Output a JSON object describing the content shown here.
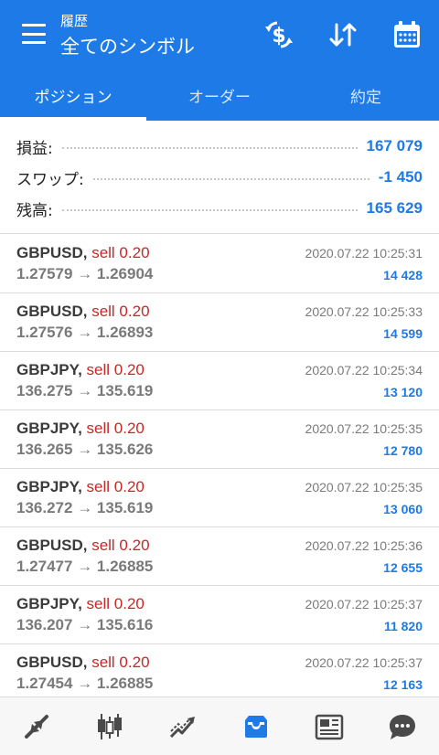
{
  "header": {
    "subtitle": "履歴",
    "title": "全てのシンボル",
    "icons": [
      "menu-icon",
      "currency-exchange-icon",
      "sort-icon",
      "calendar-icon"
    ]
  },
  "tabs": [
    {
      "label": "ポジション",
      "active": true
    },
    {
      "label": "オーダー",
      "active": false
    },
    {
      "label": "約定",
      "active": false
    }
  ],
  "summary": {
    "profit_label": "損益:",
    "profit_value": "167 079",
    "swap_label": "スワップ:",
    "swap_value": "-1 450",
    "balance_label": "残高:",
    "balance_value": "165 629"
  },
  "positions": [
    {
      "symbol": "GBPUSD,",
      "side": "sell 0.20",
      "open": "1.27579",
      "close": "1.26904",
      "time": "2020.07.22 10:25:31",
      "profit": "14 428"
    },
    {
      "symbol": "GBPUSD,",
      "side": "sell 0.20",
      "open": "1.27576",
      "close": "1.26893",
      "time": "2020.07.22 10:25:33",
      "profit": "14 599"
    },
    {
      "symbol": "GBPJPY,",
      "side": "sell 0.20",
      "open": "136.275",
      "close": "135.619",
      "time": "2020.07.22 10:25:34",
      "profit": "13 120"
    },
    {
      "symbol": "GBPJPY,",
      "side": "sell 0.20",
      "open": "136.265",
      "close": "135.626",
      "time": "2020.07.22 10:25:35",
      "profit": "12 780"
    },
    {
      "symbol": "GBPJPY,",
      "side": "sell 0.20",
      "open": "136.272",
      "close": "135.619",
      "time": "2020.07.22 10:25:35",
      "profit": "13 060"
    },
    {
      "symbol": "GBPUSD,",
      "side": "sell 0.20",
      "open": "1.27477",
      "close": "1.26885",
      "time": "2020.07.22 10:25:36",
      "profit": "12 655"
    },
    {
      "symbol": "GBPJPY,",
      "side": "sell 0.20",
      "open": "136.207",
      "close": "135.616",
      "time": "2020.07.22 10:25:37",
      "profit": "11 820"
    },
    {
      "symbol": "GBPUSD,",
      "side": "sell 0.20",
      "open": "1.27454",
      "close": "1.26885",
      "time": "2020.07.22 10:25:37",
      "profit": "12 163"
    }
  ],
  "arrow_glyph": "→",
  "bottom_nav": [
    {
      "icon": "quotes-icon",
      "active": false
    },
    {
      "icon": "candlestick-chart-icon",
      "active": false
    },
    {
      "icon": "trade-icon",
      "active": false
    },
    {
      "icon": "history-inbox-icon",
      "active": true
    },
    {
      "icon": "news-icon",
      "active": false
    },
    {
      "icon": "chat-icon",
      "active": false
    }
  ],
  "colors": {
    "accent": "#1e7ae6",
    "sell": "#c62828",
    "nav_inactive": "#4a4a4a"
  }
}
